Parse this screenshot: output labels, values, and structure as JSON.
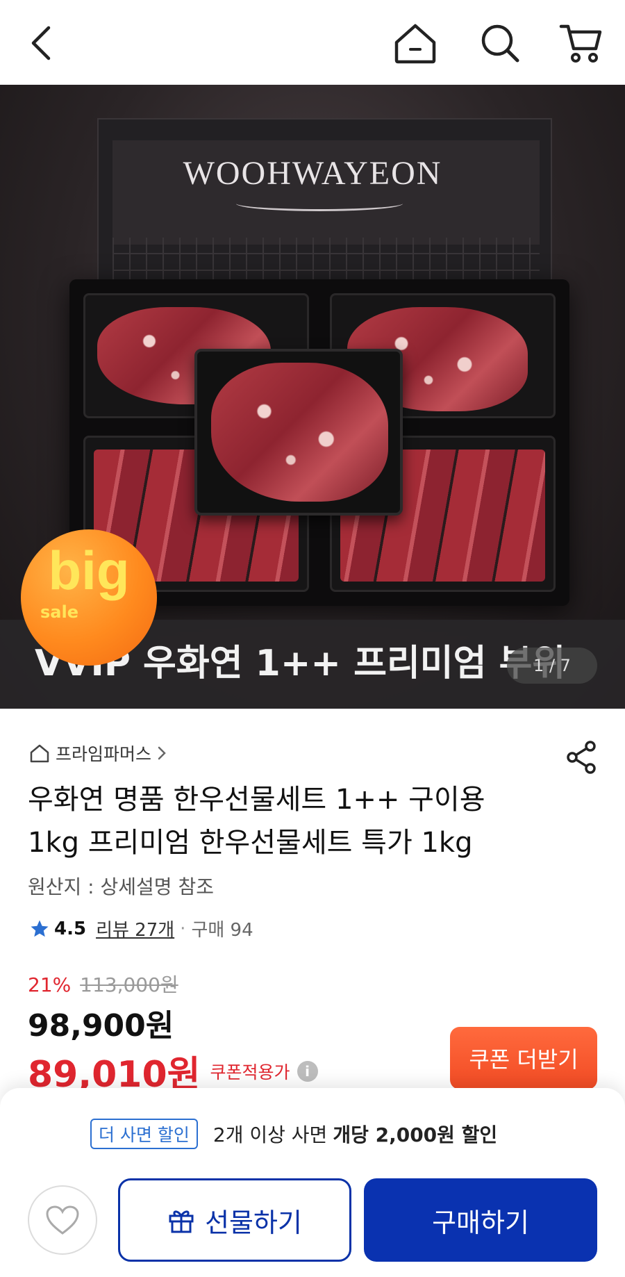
{
  "header": {
    "back_icon": "chevron-left-icon",
    "home_icon": "home-icon",
    "search_icon": "search-icon",
    "cart_icon": "cart-icon"
  },
  "hero": {
    "brand_text": "WOOHWAYEON",
    "caption": "VVIP 우화연 1++ 프리미엄 부위",
    "counter": "1 / 7",
    "badge_big": "big",
    "badge_sale": "sale"
  },
  "product": {
    "store": "프라임파머스",
    "title_line1": "우화연 명품 한우선물세트 1++ 구이용",
    "title_line2": "1kg 프리미엄 한우선물세트 특가 1kg",
    "origin": "원산지 : 상세설명 참조",
    "rating": "4.5",
    "reviews": "리뷰 27개",
    "purchases": "구매 94",
    "discount_pct": "21%",
    "original_price": "113,000원",
    "price": "98,900원",
    "coupon_price": "89,010원",
    "coupon_label": "쿠폰적용가",
    "coupon_button": "쿠폰 더받기"
  },
  "bottom": {
    "promo_tag": "더 사면 할인",
    "promo_text": "2개 이상 사면",
    "promo_bold": "개당 2,000원 할인",
    "gift_label": "선물하기",
    "buy_label": "구매하기"
  },
  "colors": {
    "accent_red": "#e0262f",
    "primary_blue": "#0a32b0",
    "coupon_orange": "#f24b24",
    "tag_blue": "#2b6fd1"
  }
}
